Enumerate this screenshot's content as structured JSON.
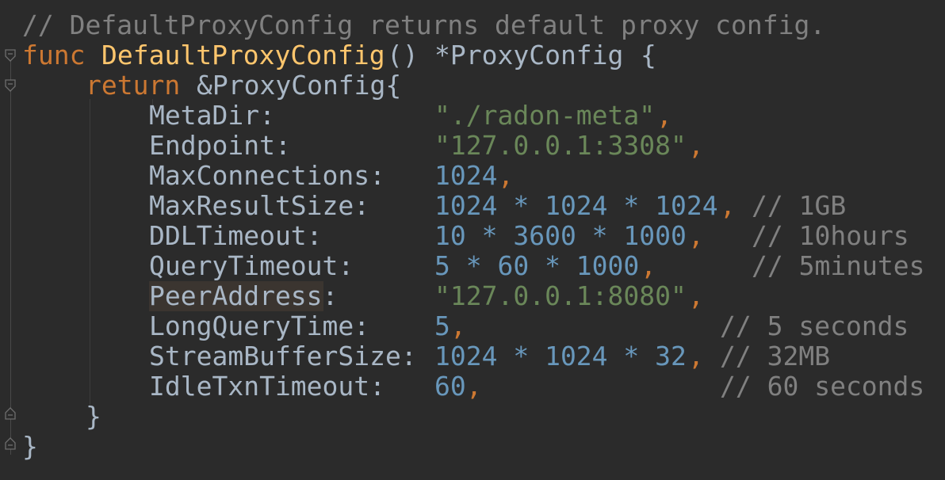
{
  "editor": {
    "comment_line": "// DefaultProxyConfig returns default proxy config.",
    "func_keyword": "func",
    "func_name": "DefaultProxyConfig",
    "func_parens": "()",
    "return_type": "*ProxyConfig",
    "open_brace": "{",
    "return_keyword": "return",
    "struct_literal": "&ProxyConfig{",
    "inner_close_brace": "}",
    "outer_close_brace": "}",
    "fields": [
      {
        "name": "MetaDir:",
        "value": "\"./radon-meta\"",
        "value_kind": "string",
        "comma": ",",
        "comment": ""
      },
      {
        "name": "Endpoint:",
        "value": "\"127.0.0.1:3308\"",
        "value_kind": "string",
        "comma": ",",
        "comment": ""
      },
      {
        "name": "MaxConnections:",
        "value": "1024",
        "value_kind": "number",
        "comma": ",",
        "comment": ""
      },
      {
        "name": "MaxResultSize:",
        "value": "1024 * 1024 * 1024",
        "value_kind": "number",
        "comma": ",",
        "comment": "// 1GB"
      },
      {
        "name": "DDLTimeout:",
        "value": "10 * 3600 * 1000",
        "value_kind": "number",
        "comma": ",",
        "comment": "// 10hours"
      },
      {
        "name": "QueryTimeout:",
        "value": "5 * 60 * 1000",
        "value_kind": "number",
        "comma": ",",
        "comment": "// 5minutes"
      },
      {
        "name": "PeerAddress:",
        "value": "\"127.0.0.1:8080\"",
        "value_kind": "string",
        "comma": ",",
        "comment": ""
      },
      {
        "name": "LongQueryTime:",
        "value": "5",
        "value_kind": "number",
        "comma": ",",
        "comment": "// 5 seconds"
      },
      {
        "name": "StreamBufferSize:",
        "value": "1024 * 1024 * 32",
        "value_kind": "number",
        "comma": ",",
        "comment": "// 32MB"
      },
      {
        "name": "IdleTxnTimeout:",
        "value": "60",
        "value_kind": "number",
        "comma": ",",
        "comment": "// 60 seconds"
      }
    ]
  },
  "colors": {
    "background": "#2b2b2b",
    "comment": "#808080",
    "keyword": "#cc7832",
    "function_name": "#ffc66d",
    "string": "#6a8759",
    "number": "#6897bb",
    "text": "#a9b7c6"
  }
}
